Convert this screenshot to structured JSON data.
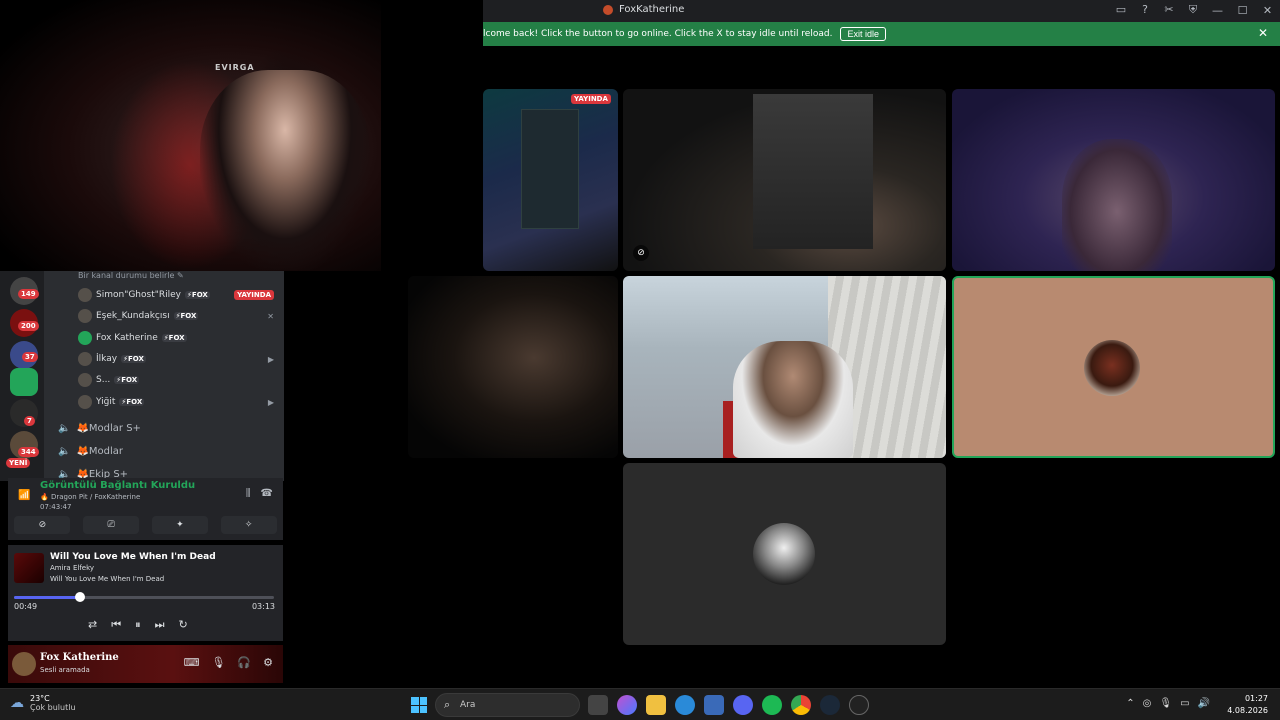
{
  "window": {
    "title": "FoxKatherine",
    "icons": [
      "inbox-icon",
      "help-icon",
      "tools-icon",
      "shield-icon"
    ],
    "controls": [
      "minimize",
      "maximize",
      "close"
    ]
  },
  "banner": {
    "message": "lcome back! Click the button to go online. Click the X to stay idle until reload.",
    "button_label": "Exit idle",
    "close_glyph": "✕",
    "color": "#248046"
  },
  "webcam": {
    "brand": "EVIRGA"
  },
  "guilds": [
    {
      "badge": "149"
    },
    {
      "badge": "200"
    },
    {
      "badge": "37"
    },
    {
      "badge": ""
    },
    {
      "badge": "7"
    },
    {
      "badge": "344"
    }
  ],
  "guild_new_label": "YENİ",
  "channel_list": {
    "status_hint": "Bir kanal durumu belirle ✎",
    "voice_users": [
      {
        "name": "Simon\"Ghost\"Riley",
        "tag": "⚡FOX",
        "live": "YAYINDA"
      },
      {
        "name": "Eşek_Kundakçısı",
        "tag": "⚡FOX"
      },
      {
        "name": "Fox Katherine",
        "tag": "⚡FOX"
      },
      {
        "name": "İlkay",
        "tag": "⚡FOX"
      },
      {
        "name": "S...",
        "tag": "⚡FOX"
      },
      {
        "name": "Yiğit",
        "tag": "⚡FOX"
      }
    ],
    "channels": [
      {
        "name": "🦊Modlar S+"
      },
      {
        "name": "🦊Modlar"
      },
      {
        "name": "🦊Ekip S+"
      }
    ]
  },
  "voice": {
    "status": "Görüntülü Bağlantı Kuruldu",
    "location": "🔥 Dragon Pit / FoxKatherine",
    "elapsed": "07:43:47",
    "status_color": "#23a559"
  },
  "music": {
    "song": "Will You Love Me When I'm Dead",
    "artist": "Amira Elfeky",
    "album": "Will You Love Me When I'm Dead",
    "current": "00:49",
    "total": "03:13",
    "progress": 0.254
  },
  "user": {
    "name": "Fox Katherine",
    "status": "Sesli aramada"
  },
  "tiles": {
    "screen_badge": "YAYINDA"
  },
  "taskbar": {
    "temperature": "23°C",
    "weather": "Çok bulutlu",
    "search_placeholder": "Ara",
    "time": "01:27",
    "date": "4.08.2026",
    "accent": "#4cc2ff"
  }
}
